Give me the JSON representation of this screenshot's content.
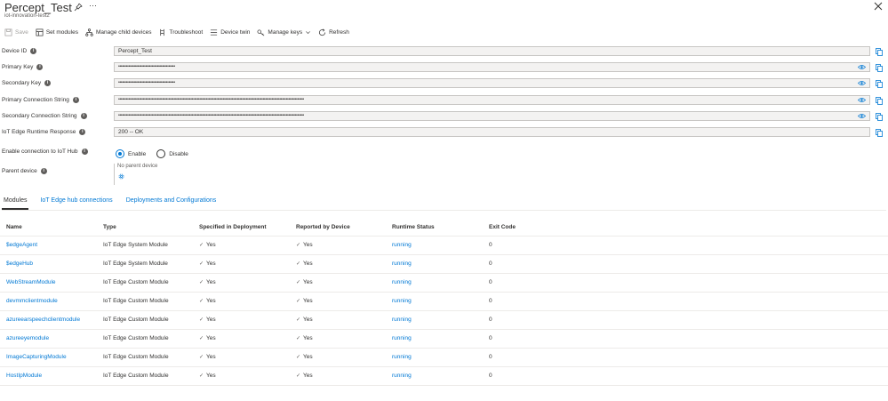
{
  "header": {
    "title": "Percept_Test",
    "subtitle": "iot-innovation-test2",
    "more": "···"
  },
  "toolbar": {
    "save": "Save",
    "set_modules": "Set modules",
    "manage_child": "Manage child devices",
    "troubleshoot": "Troubleshoot",
    "device_twin": "Device twin",
    "manage_keys": "Manage keys",
    "refresh": "Refresh"
  },
  "fields": {
    "device_id": {
      "label": "Device ID",
      "value": "Percept_Test"
    },
    "primary_key": {
      "label": "Primary Key",
      "value": "••••••••••••••••••••••••••••••••••••••••••••"
    },
    "secondary_key": {
      "label": "Secondary Key",
      "value": "••••••••••••••••••••••••••••••••••••••••••••"
    },
    "primary_conn": {
      "label": "Primary Connection String",
      "value": "••••••••••••••••••••••••••••••••••••••••••••••••••••••••••••••••••••••••••••••••••••••••••••••••••••••••••••••••••••••••••••••••••••••••••••••••"
    },
    "secondary_conn": {
      "label": "Secondary Connection String",
      "value": "••••••••••••••••••••••••••••••••••••••••••••••••••••••••••••••••••••••••••••••••••••••••••••••••••••••••••••••••••••••••••••••••••••••••••••••••"
    },
    "runtime_response": {
      "label": "IoT Edge Runtime Response",
      "value": "200 -- OK"
    },
    "enable_conn": {
      "label": "Enable connection to IoT Hub",
      "options": [
        "Enable",
        "Disable"
      ],
      "selected": "Enable"
    },
    "parent_device": {
      "label": "Parent device",
      "value": "No parent device"
    }
  },
  "tabs": [
    "Modules",
    "IoT Edge hub connections",
    "Deployments and Configurations"
  ],
  "table": {
    "headers": [
      "Name",
      "Type",
      "Specified in Deployment",
      "Reported by Device",
      "Runtime Status",
      "Exit Code"
    ],
    "rows": [
      {
        "name": "$edgeAgent",
        "type": "IoT Edge System Module",
        "specified": "Yes",
        "reported": "Yes",
        "status": "running",
        "exit": "0"
      },
      {
        "name": "$edgeHub",
        "type": "IoT Edge System Module",
        "specified": "Yes",
        "reported": "Yes",
        "status": "running",
        "exit": "0"
      },
      {
        "name": "WebStreamModule",
        "type": "IoT Edge Custom Module",
        "specified": "Yes",
        "reported": "Yes",
        "status": "running",
        "exit": "0"
      },
      {
        "name": "devmmclientmodule",
        "type": "IoT Edge Custom Module",
        "specified": "Yes",
        "reported": "Yes",
        "status": "running",
        "exit": "0"
      },
      {
        "name": "azureearspeechclientmodule",
        "type": "IoT Edge Custom Module",
        "specified": "Yes",
        "reported": "Yes",
        "status": "running",
        "exit": "0"
      },
      {
        "name": "azureeyemodule",
        "type": "IoT Edge Custom Module",
        "specified": "Yes",
        "reported": "Yes",
        "status": "running",
        "exit": "0"
      },
      {
        "name": "ImageCapturingModule",
        "type": "IoT Edge Custom Module",
        "specified": "Yes",
        "reported": "Yes",
        "status": "running",
        "exit": "0"
      },
      {
        "name": "HostIpModule",
        "type": "IoT Edge Custom Module",
        "specified": "Yes",
        "reported": "Yes",
        "status": "running",
        "exit": "0"
      }
    ]
  },
  "colors": {
    "accent": "#0078d4",
    "text": "#323130",
    "field_bg": "#f3f2f1"
  }
}
